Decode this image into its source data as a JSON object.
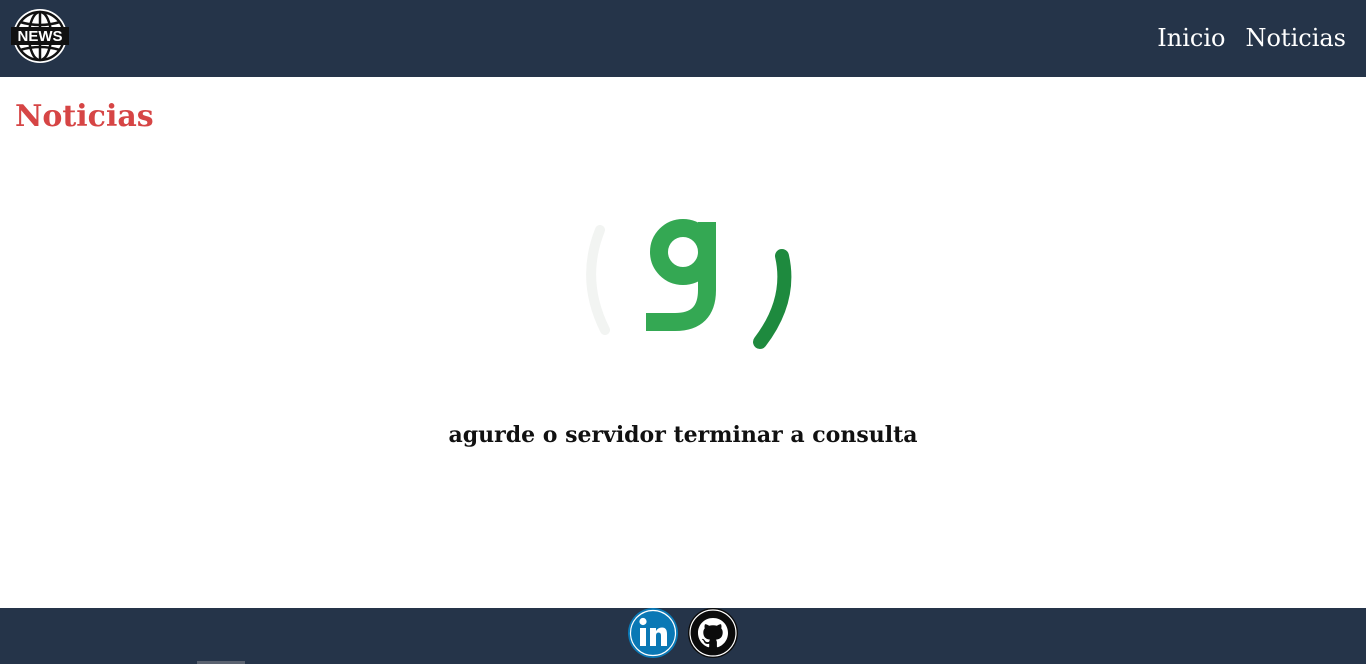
{
  "header": {
    "logo_text": "NEWS",
    "nav": [
      {
        "label": "Inicio"
      },
      {
        "label": "Noticias"
      }
    ]
  },
  "main": {
    "title": "Noticias",
    "status_message": "agurde o servidor terminar a consulta"
  },
  "footer": {
    "icons": [
      "linkedin-icon",
      "github-icon"
    ]
  },
  "colors": {
    "navbar_bg": "#253449",
    "title": "#d64545",
    "loader_green": "#34a853",
    "loader_dark_green": "#1e8a3e",
    "linkedin_blue": "#0a78b5"
  }
}
